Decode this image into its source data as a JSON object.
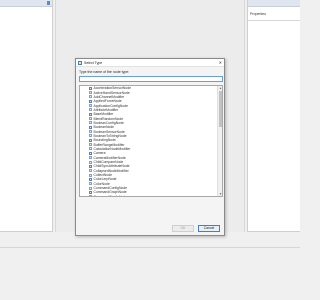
{
  "right_panel": {
    "title": "Properties"
  },
  "dialog": {
    "title": "Select Type",
    "prompt": "Type the name of the node type:",
    "search_value": "",
    "ok_label": "OK",
    "cancel_label": "Cancel",
    "items": [
      "AccelerationSensorNode",
      "ActiveHandSensorNode",
      "AddChannelModifier",
      "AppliedForceNode",
      "ApplicationConfigNode",
      "AttributeModifier",
      "BaseModifier",
      "BlendRandomNode",
      "BooleanConfigNode",
      "BooleanNode",
      "BooleanSensorNode",
      "BooleanToStringNode",
      "BoundingNode",
      "BufferRangeModifier",
      "CalculationNodeModifier",
      "Camera",
      "CameraModifierNode",
      "ChildCompareNode",
      "ChildSyncAttributeNode",
      "CollapsedNodeModifier",
      "CollectNode",
      "ColorLerpNode",
      "ColorNode",
      "CommandConfigNode",
      "CommandGraphNode",
      "CommandConfigNode",
      "ConfigNode",
      "ConnectNode"
    ]
  }
}
